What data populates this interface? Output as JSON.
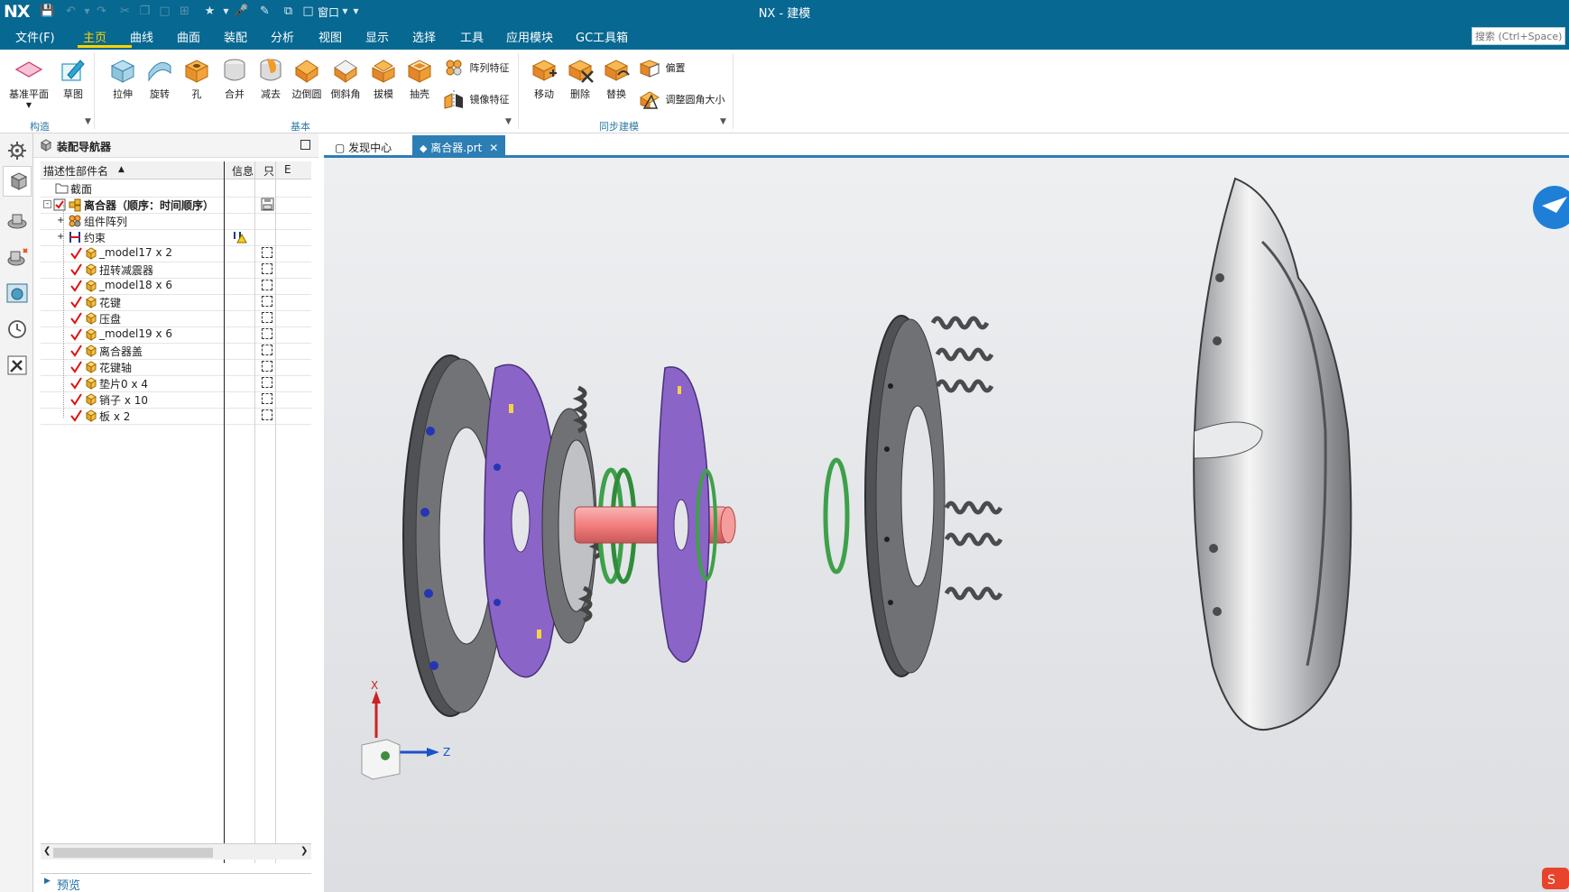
{
  "app": {
    "logo": "NX",
    "window_title": "NX - 建模"
  },
  "quick_access": {
    "window_menu_label": "窗口"
  },
  "menu": {
    "tabs": [
      {
        "label": "文件(F)"
      },
      {
        "label": "主页"
      },
      {
        "label": "曲线"
      },
      {
        "label": "曲面"
      },
      {
        "label": "装配"
      },
      {
        "label": "分析"
      },
      {
        "label": "视图"
      },
      {
        "label": "显示"
      },
      {
        "label": "选择"
      },
      {
        "label": "工具"
      },
      {
        "label": "应用模块"
      },
      {
        "label": "GC工具箱"
      }
    ],
    "active_index": 1
  },
  "search": {
    "placeholder": "搜索 (Ctrl+Space)"
  },
  "ribbon": {
    "construct": {
      "buttons": [
        "基准平面",
        "草图"
      ],
      "group": "构造"
    },
    "basic": {
      "buttons": [
        "拉伸",
        "旋转",
        "孔",
        "合并",
        "减去",
        "边倒圆",
        "倒斜角",
        "拔模",
        "抽壳"
      ],
      "small": [
        "阵列特征",
        "镜像特征"
      ],
      "group": "基本"
    },
    "sync": {
      "buttons": [
        "移动",
        "删除",
        "替换"
      ],
      "small": [
        "偏置",
        "调整圆角大小"
      ],
      "group": "同步建模"
    }
  },
  "navigator": {
    "title": "装配导航器",
    "columns": {
      "name": "描述性部件名",
      "info": "信息",
      "readonly": "只",
      "extra": "E"
    },
    "tree": [
      {
        "label": "截面",
        "icon": "folder-icon",
        "level": 1,
        "check": false,
        "bold": false
      },
      {
        "label": "离合器（顺序：时间顺序）",
        "icon": "assembly-icon",
        "level": 0,
        "check": true,
        "bold": true
      },
      {
        "label": "组件阵列",
        "icon": "component-array-icon",
        "level": 1,
        "check": false,
        "bold": false
      },
      {
        "label": "约束",
        "icon": "constraint-icon",
        "level": 1,
        "check": false,
        "bold": false
      },
      {
        "label": "_model17 x 2",
        "icon": "part-icon",
        "level": 2,
        "check": true,
        "bold": false
      },
      {
        "label": "扭转减震器",
        "icon": "part-icon",
        "level": 2,
        "check": true,
        "bold": false
      },
      {
        "label": "_model18 x 6",
        "icon": "part-icon",
        "level": 2,
        "check": true,
        "bold": false
      },
      {
        "label": "花键",
        "icon": "part-icon",
        "level": 2,
        "check": true,
        "bold": false
      },
      {
        "label": "压盘",
        "icon": "part-icon",
        "level": 2,
        "check": true,
        "bold": false
      },
      {
        "label": "_model19 x 6",
        "icon": "part-icon",
        "level": 2,
        "check": true,
        "bold": false
      },
      {
        "label": "离合器盖",
        "icon": "part-icon",
        "level": 2,
        "check": true,
        "bold": false
      },
      {
        "label": "花键轴",
        "icon": "part-icon",
        "level": 2,
        "check": true,
        "bold": false
      },
      {
        "label": "垫片0 x 4",
        "icon": "part-icon",
        "level": 2,
        "check": true,
        "bold": false
      },
      {
        "label": "销子 x 10",
        "icon": "part-icon",
        "level": 2,
        "check": true,
        "bold": false
      },
      {
        "label": "板 x 2",
        "icon": "part-icon",
        "level": 2,
        "check": true,
        "bold": false
      }
    ],
    "preview_label": "预览"
  },
  "doc_tabs": [
    {
      "label": "发现中心",
      "active": false
    },
    {
      "label": "离合器.prt",
      "active": true
    }
  ],
  "triad": {
    "x_label": "X",
    "z_label": "Z"
  },
  "colors": {
    "brand": "#076891",
    "active_tab": "#ffd400",
    "doc_tab": "#2c7eb4"
  }
}
